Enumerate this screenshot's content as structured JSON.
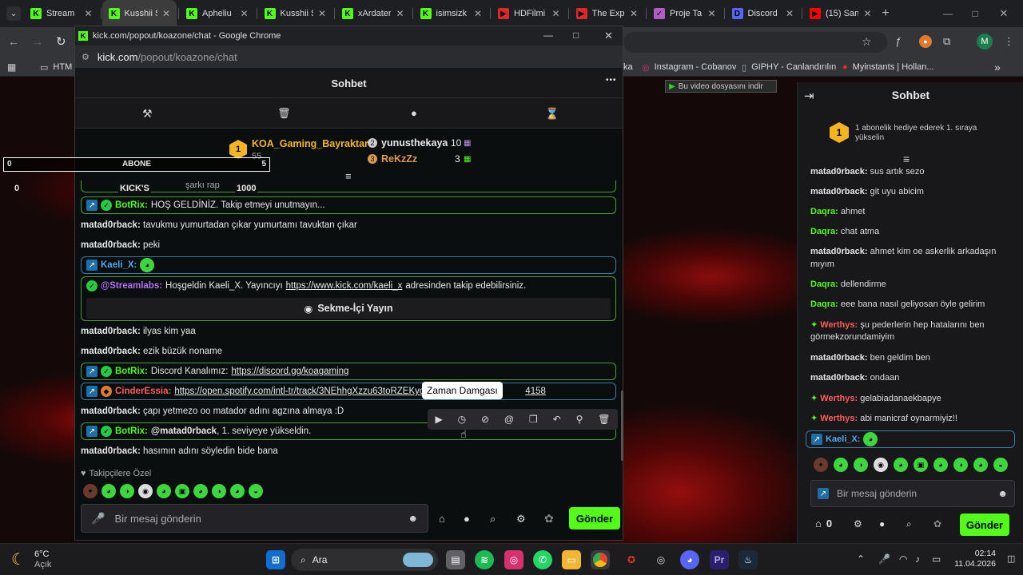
{
  "tabs": [
    {
      "title": "Stream",
      "color": "#53fc18",
      "glyph": "K"
    },
    {
      "title": "Kusshii S",
      "color": "#53fc18",
      "glyph": "K"
    },
    {
      "title": "Apheliu",
      "color": "#53fc18",
      "glyph": "K"
    },
    {
      "title": "Kusshii S",
      "color": "#53fc18",
      "glyph": "K"
    },
    {
      "title": "xArdater",
      "color": "#53fc18",
      "glyph": "K"
    },
    {
      "title": "isimsizk",
      "color": "#53fc18",
      "glyph": "K"
    },
    {
      "title": "HDFilmi",
      "color": "#e0262d",
      "glyph": "▶"
    },
    {
      "title": "The Exp",
      "color": "#e0262d",
      "glyph": "▶"
    },
    {
      "title": "Proje Ta",
      "color": "#b05cc4",
      "glyph": "✓"
    },
    {
      "title": "Discord",
      "color": "#5865f2",
      "glyph": "D"
    },
    {
      "title": "(15) San",
      "color": "#ff0000",
      "glyph": "▶"
    }
  ],
  "bookmarks": {
    "html": "HTM",
    "a": "ka",
    "instagram": "Instagram - Cobanov",
    "giphy": "GIPHY - Canlandırılın",
    "myinstants": "Myinstants | Hollan...",
    "more": "»"
  },
  "popup": {
    "window_title": "kick.com/popout/koazone/chat - Google Chrome",
    "url_host": "kick.com",
    "url_path": "/popout/koazone/chat",
    "header_title": "Sohbet",
    "menu": "•••"
  },
  "leaderboard": {
    "first_rank": "1",
    "first_name": "KOA_Gaming_Bayraktar",
    "first_count": "55",
    "second_rank": "2",
    "second_name": "yunusthekaya",
    "second_count": "10",
    "third_rank": "3",
    "third_name": "ReKzZz",
    "third_count": "3"
  },
  "overlay": {
    "left_value": "0",
    "label": "ABONE",
    "right_value": "5",
    "bottom_left": "0",
    "kicks_label": "KICK'S",
    "kicks_value": "1000"
  },
  "chat": {
    "partial_text": "şarkı rap",
    "msg1_user": "BotRix:",
    "msg1_text": "HOŞ GELDİNİZ. Takip etmeyi unutmayın...",
    "msg2_user": "matad0rback:",
    "msg2_text": "tavukmu yumurtadan çıkar yumurtamı tavuktan çıkar",
    "msg3_user": "matad0rback:",
    "msg3_text": "peki",
    "msg4_user": "Kaeli_X:",
    "msg5_user": "@Streamlabs:",
    "msg5_text_a": "Hoşgeldin Kaeli_X. Yayıncıyı",
    "msg5_link": "https://www.kick.com/kaeli_x",
    "msg5_text_b": "adresinden takip edebilirsiniz.",
    "msg5_button": "Sekme-İçi Yayın",
    "msg6_user": "matad0rback:",
    "msg6_text": "ilyas kim yaa",
    "msg7_user": "matad0rback:",
    "msg7_text": "ezik büzük noname",
    "msg8_user": "BotRix:",
    "msg8_text": "Discord Kanalımız:",
    "msg8_link": "https://discord.gg/koagaming",
    "msg9_user": "CinderEssia:",
    "msg9_link_a": "https://open.spotify.com/intl-tr/track/3NEhhgXzzu63toRZEKyq",
    "msg9_link_b": "4158",
    "msg10_user": "matad0rback:",
    "msg10_text": "çapı yetmezo oo matador adını agzına almaya :D",
    "msg11_user": "BotRix:",
    "msg11_mention": "@matad0rback",
    "msg11_text": ", 1. seviyeye yükseldin.",
    "msg12_user": "matad0rback:",
    "msg12_text": "hasımın adını söyledin bide bana",
    "tooltip": "Zaman Damgası"
  },
  "bottom": {
    "followers_only": "Takipçilere Özel",
    "input_placeholder": "Bir mesaj gönderin",
    "send": "Gönder"
  },
  "right_chat": {
    "title": "Sohbet",
    "promo_rank": "1",
    "promo_text": "1 abonelik hediye ederek 1. sıraya yükselin",
    "messages": [
      {
        "user": "matad0rback:",
        "text": "sus artık sezo",
        "color": "#e6e6e6"
      },
      {
        "user": "matad0rback:",
        "text": "git uyu abicim",
        "color": "#e6e6e6"
      },
      {
        "user": "Daqra:",
        "text": "ahmet",
        "color": "#53fc18"
      },
      {
        "user": "Daqra:",
        "text": "chat atma",
        "color": "#53fc18"
      },
      {
        "user": "matad0rback:",
        "text": "ahmet kim oe askerlik arkadaşın",
        "color": "#e6e6e6"
      },
      {
        "user": "",
        "text": "mıyım",
        "color": "#e6e6e6"
      },
      {
        "user": "Daqra:",
        "text": "dellendirme",
        "color": "#53fc18"
      },
      {
        "user": "Daqra:",
        "text": "eee bana nasıl geliyosan öyle gelirim",
        "color": "#53fc18"
      },
      {
        "user": "Werthys:",
        "text": "şu pederlerin hep hatalarını ben",
        "color": "#ff5b5b"
      },
      {
        "user": "",
        "text": "görmekzorundamiyim",
        "color": "#e6e6e6"
      },
      {
        "user": "matad0rback:",
        "text": "ben geldim ben",
        "color": "#e6e6e6"
      },
      {
        "user": "matad0rback:",
        "text": "ondaan",
        "color": "#e6e6e6"
      },
      {
        "user": "Werthys:",
        "text": "gelabiadanaekbapye",
        "color": "#ff5b5b"
      },
      {
        "user": "Werthys:",
        "text": "abi manicraf oynarmiyiz!!",
        "color": "#ff5b5b"
      }
    ],
    "kaeli": "Kaeli_X:",
    "input_placeholder": "Bir mesaj gönderin",
    "count": "0",
    "send": "Gönder"
  },
  "other": {
    "download_hint": "Bu video dosyasını indir",
    "profile_initial": "M"
  },
  "taskbar": {
    "weather_temp": "6°C",
    "weather_desc": "Açık",
    "search": "Ara",
    "time": "02:14",
    "date": "11.04.2026"
  }
}
